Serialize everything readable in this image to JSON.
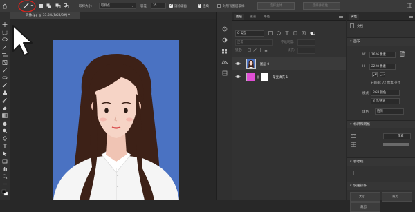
{
  "optbar": {
    "sample_size_label": "取样大小:",
    "sample_size_value": "取样点",
    "tolerance_label": "容差:",
    "tolerance_value": "35",
    "antialias_label": "消除锯齿",
    "contiguous_label": "连续",
    "sample_all_label": "对所有图层取样",
    "select_subject_label": "选择主体",
    "select_mask_label": "选择并遮住..."
  },
  "document": {
    "tab_title": "头像.jpg @ 33.3%(RGB/8#) *"
  },
  "layers_panel": {
    "tabs": [
      "图层",
      "通道",
      "路径"
    ],
    "filter_kind": "Q 类型",
    "blend_mode": "正常",
    "opacity_label": "不透明度:",
    "lock_label": "锁定:",
    "fill_label": "填充:",
    "layers": [
      {
        "name": "图层 0"
      },
      {
        "name": "渐变填充 1"
      }
    ]
  },
  "properties_panel": {
    "tab": "属性",
    "doc_label": "文档",
    "canvas_section": "画布",
    "w_label": "W",
    "w_value": "1626 像素",
    "h_label": "H",
    "h_value": "2228 像素",
    "resolution": "分辨率: 72 像素/英寸",
    "mode_label": "模式",
    "mode_value": "RGB 颜色",
    "bit_depth": "8 位/通道",
    "fill_label": "填色",
    "fill_value": "透明",
    "rulers_section": "标尺和网格",
    "ruler_unit": "像素",
    "guides_section": "参考线",
    "quick_actions_section": "快速操作",
    "quick_size": "大小",
    "quick_crop": "裁剪",
    "quick_crop2": "裁剪"
  },
  "colors": {
    "portrait_bg": "#4a72c2",
    "hair": "#3d2117",
    "skin": "#f6d4c6",
    "gradient_swatch": "#e04fd6",
    "annotation_circle": "#d9231c"
  }
}
